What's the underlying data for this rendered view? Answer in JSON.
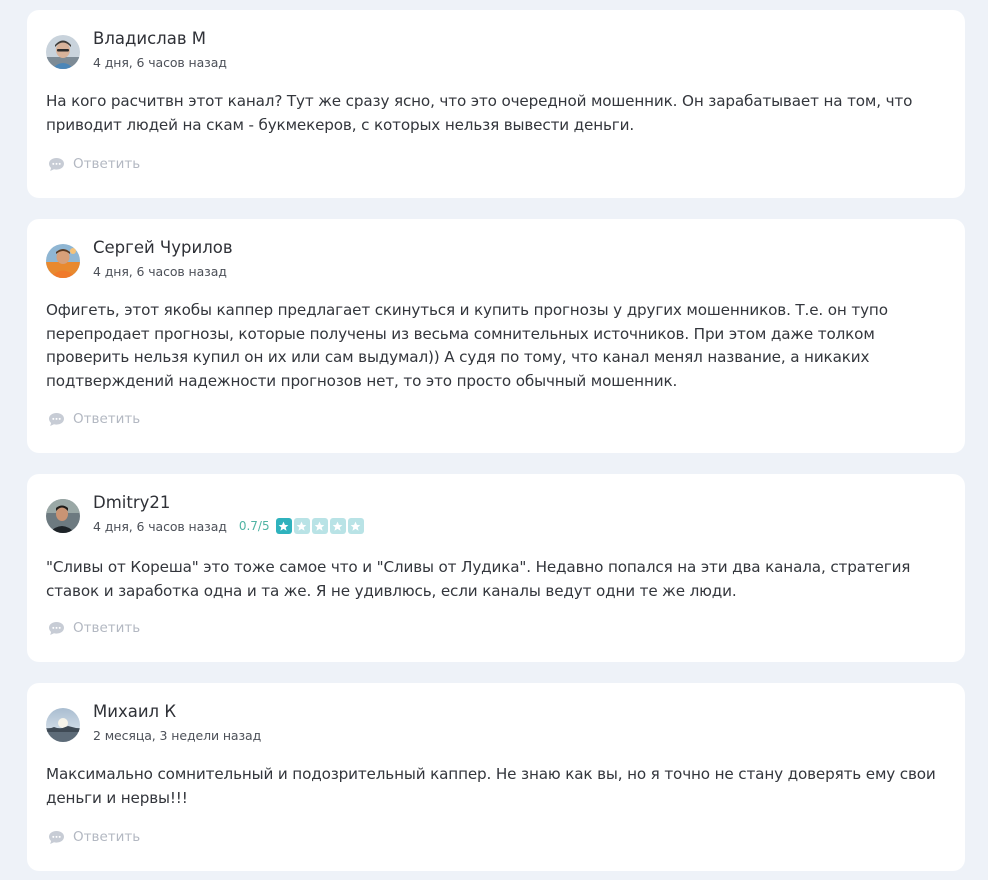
{
  "reply_label": "Ответить",
  "colors": {
    "background": "#eef2f8",
    "card": "#ffffff",
    "rating_text": "#4fb3a3",
    "star_on": "#2fb2bd",
    "star_off": "#b9e3e6",
    "reply_text": "#b3b8c2"
  },
  "comments": [
    {
      "author": "Владислав М",
      "time": "4 дня, 6 часов назад",
      "text": "На кого расчитвн этот канал? Тут же сразу ясно, что это очередной мошенник. Он зарабатывает на том, что приводит людей на скам - букмекеров, с которых нельзя вывести деньги."
    },
    {
      "author": "Сергей Чурилов",
      "time": "4 дня, 6 часов назад",
      "text": "Офигеть, этот якобы каппер предлагает скинуться и купить прогнозы у других мошенников. Т.е. он тупо перепродает прогнозы, которые получены из весьма сомнительных источников. При этом даже толком проверить нельзя купил он их или сам выдумал)) А судя по тому, что канал менял название, а никаких подтверждений надежности прогнозов нет, то это просто обычный мошенник."
    },
    {
      "author": "Dmitry21",
      "time": "4 дня, 6 часов назад",
      "rating": "0.7/5",
      "rating_value": 0.7,
      "rating_max": 5,
      "text": "\"Сливы от Кореша\" это тоже самое что и \"Сливы от Лудика\". Недавно попался на эти два канала, стратегия ставок и заработка одна и та же. Я не удивлюсь, если каналы ведут одни те же люди."
    },
    {
      "author": "Михаил К",
      "time": "2 месяца, 3 недели назад",
      "text": "Максимально сомнительный и подозрительный каппер. Не знаю как вы, но я точно не стану доверять ему свои деньги и нервы!!!"
    }
  ]
}
